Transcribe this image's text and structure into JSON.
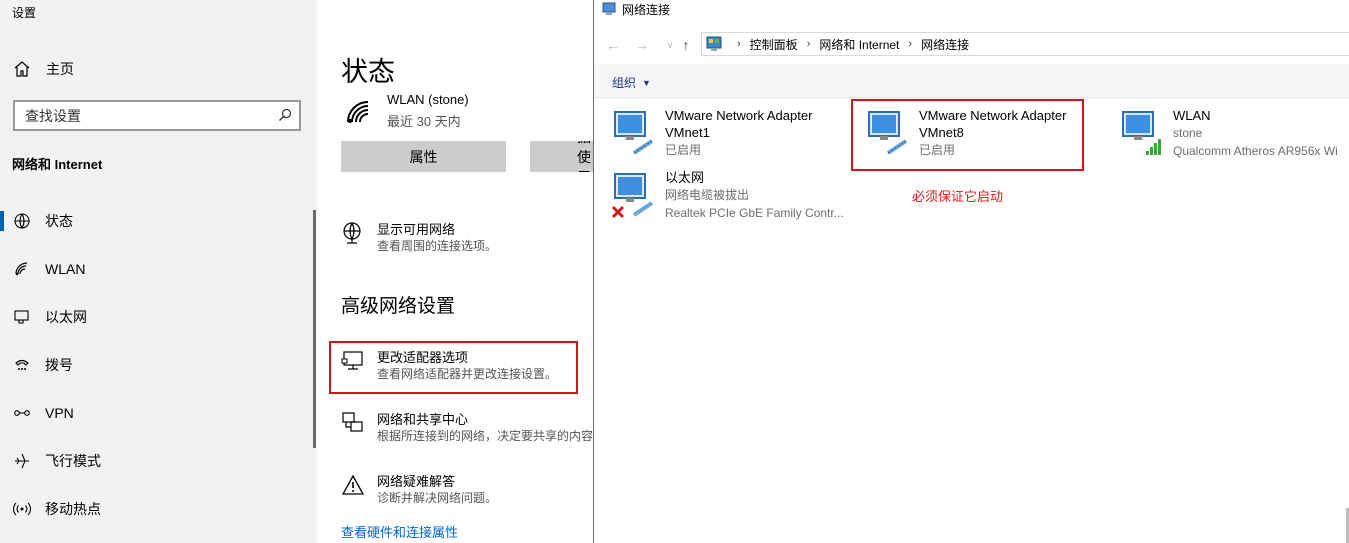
{
  "settings": {
    "window_title": "设置",
    "home_label": "主页",
    "search_placeholder": "查找设置",
    "group_heading": "网络和 Internet",
    "nav_items": [
      {
        "label": "状态",
        "icon": "home-status-icon"
      },
      {
        "label": "WLAN",
        "icon": "wifi-icon"
      },
      {
        "label": "以太网",
        "icon": "ethernet-icon"
      },
      {
        "label": "拨号",
        "icon": "dialup-icon"
      },
      {
        "label": "VPN",
        "icon": "vpn-icon"
      },
      {
        "label": "飞行模式",
        "icon": "airplane-icon"
      },
      {
        "label": "移动热点",
        "icon": "hotspot-icon"
      }
    ],
    "content": {
      "title": "状态",
      "wlan_name": "WLAN (stone)",
      "wlan_sub": "最近 30 天内",
      "btn_properties": "属性",
      "btn_data": "数据使用量",
      "show_networks_title": "显示可用网络",
      "show_networks_sub": "查看周围的连接选项。",
      "advanced_heading": "高级网络设置",
      "adapter_options_title": "更改适配器选项",
      "adapter_options_sub": "查看网络适配器并更改连接设置。",
      "sharing_center_title": "网络和共享中心",
      "sharing_center_sub": "根据所连接到的网络，决定要共享的内容。",
      "troubleshoot_title": "网络疑难解答",
      "troubleshoot_sub": "诊断并解决网络问题。",
      "hardware_link": "查看硬件和连接属性"
    }
  },
  "netconn": {
    "window_title": "网络连接",
    "breadcrumb": [
      "控制面板",
      "网络和 Internet",
      "网络连接"
    ],
    "organize_label": "组织",
    "adapters": [
      {
        "name": "VMware Network Adapter",
        "name2": "VMnet1",
        "status": "已启用",
        "detail": ""
      },
      {
        "name": "VMware Network Adapter",
        "name2": "VMnet8",
        "status": "已启用",
        "detail": ""
      },
      {
        "name": "WLAN",
        "name2": "",
        "status": "stone",
        "detail": "Qualcomm Atheros AR956x Wi"
      },
      {
        "name": "以太网",
        "name2": "",
        "status": "网络电缆被拔出",
        "detail": "Realtek PCIe GbE Family Contr..."
      }
    ],
    "annotation": "必须保证它启动"
  },
  "colors": {
    "accent": "#0063b1",
    "highlight_red": "#d0141a",
    "link_blue": "#0066cc"
  }
}
